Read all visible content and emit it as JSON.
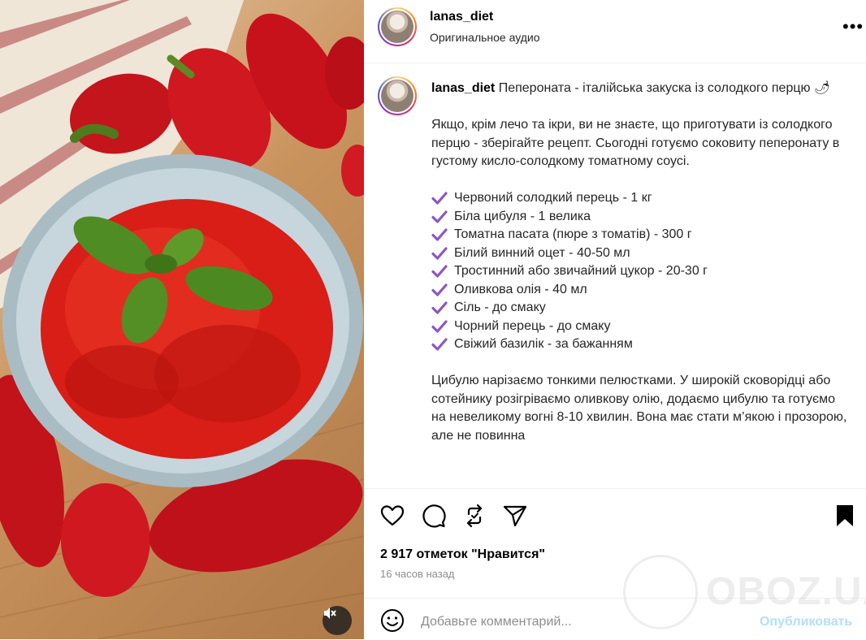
{
  "media": {
    "image_name": "peperonata-dish-photo",
    "mute_icon": "speaker-muted-icon"
  },
  "header": {
    "username": "lanas_diet",
    "audio": "Оригинальное аудио",
    "more_icon": "more-options-icon",
    "more_glyph": "•••"
  },
  "caption": {
    "username": "lanas_diet",
    "title": "Пепероната - італійська закуска із солодкого перцю",
    "title_emoji": "🌶",
    "intro": "Якщо, крім лечо та ікри, ви не знаєте, що приготувати із солодкого перцю - зберігайте рецепт. Сьогодні готуємо соковиту пеперонату в густому кисло-солодкому томатному соусі.",
    "ingredients": [
      "Червоний солодкий перець - 1 кг",
      "Біла цибуля - 1 велика",
      "Томатна пасата (пюре з томатів) - 300 г",
      "Білий винний оцет - 40-50 мл",
      "Тростинний або звичайний цукор - 20-30 г",
      "Оливкова олія - 40 мл",
      "Сіль - до смаку",
      "Чорний перець - до смаку",
      "Свіжий базилік - за бажанням"
    ],
    "check_icon": "purple-checkmark-icon",
    "check_color": "#8d55c7",
    "method": "Цибулю нарізаємо тонкими пелюстками. У широкій сковорідці або сотейнику розігріваємо оливкову олію, додаємо цибулю та готуємо на невеликому вогні 8-10 хвилин. Вона має стати м’якою і прозорою, але не повинна"
  },
  "actions": {
    "like_icon": "heart-icon",
    "comment_icon": "comment-icon",
    "repost_icon": "repost-icon",
    "share_icon": "send-icon",
    "save_icon": "bookmark-icon",
    "likes": "2 917 отметок \"Нравится\"",
    "time_ago": "16 часов назад"
  },
  "comment": {
    "emoji_icon": "emoji-smiley-icon",
    "placeholder": "Добавьте комментарий...",
    "publish": "Опубликовать"
  },
  "watermark": {
    "text": "OBOZ.UA"
  }
}
